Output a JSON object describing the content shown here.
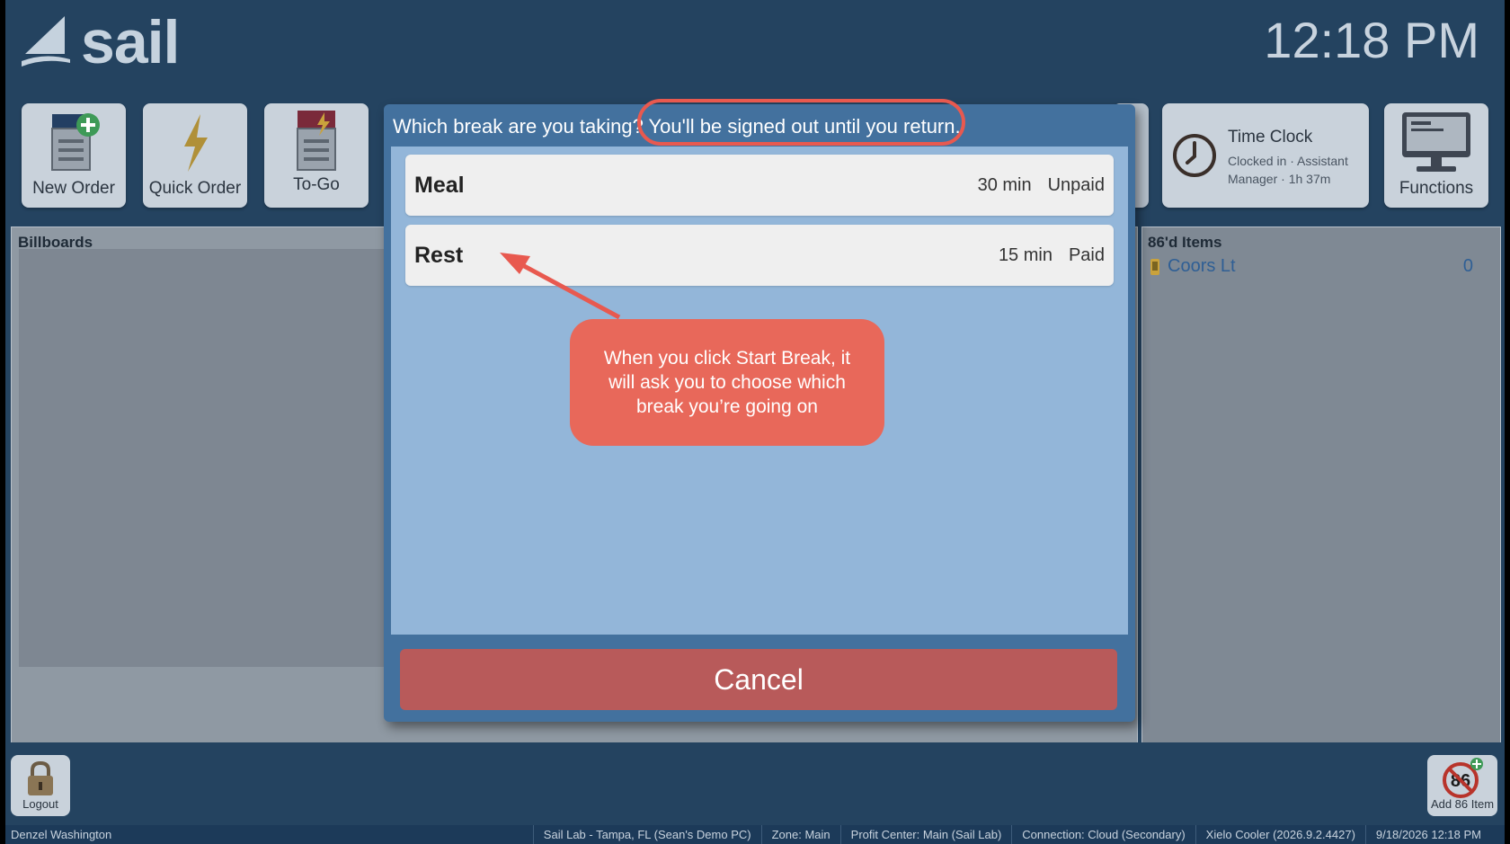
{
  "header": {
    "logo_text": "sail",
    "clock": "12:18 PM"
  },
  "toolbar": {
    "new_order": "New Order",
    "quick_order": "Quick Order",
    "to_go": "To-Go",
    "functions": "Functions"
  },
  "time_clock": {
    "title": "Time Clock",
    "status": "Clocked in · Assistant Manager · 1h 37m"
  },
  "billboards": {
    "title": "Billboards"
  },
  "eighty_sixed": {
    "title": "86'd Items",
    "items": [
      {
        "name": "Coors Lt",
        "count": "0"
      }
    ]
  },
  "modal": {
    "prompt_question": "Which break are you taking? ",
    "prompt_note": "You'll be signed out until you return.",
    "options": [
      {
        "name": "Meal",
        "duration": "30 min",
        "pay": "Unpaid"
      },
      {
        "name": "Rest",
        "duration": "15 min",
        "pay": "Paid"
      }
    ],
    "cancel_label": "Cancel"
  },
  "annotation": {
    "callout_text": "When you click Start Break, it will ask you to choose which break you’re going on",
    "color": "#e8594f"
  },
  "bottom": {
    "logout": "Logout",
    "add86": "Add 86 Item"
  },
  "statusbar": {
    "user": "Denzel Washington",
    "location": "Sail Lab - Tampa, FL (Sean's Demo PC)",
    "zone": "Zone: Main",
    "profit_center": "Profit Center: Main (Sail Lab)",
    "connection": "Connection: Cloud (Secondary)",
    "version": "Xielo Cooler (2026.9.2.4427)",
    "datetime": "9/18/2026 12:18 PM"
  }
}
